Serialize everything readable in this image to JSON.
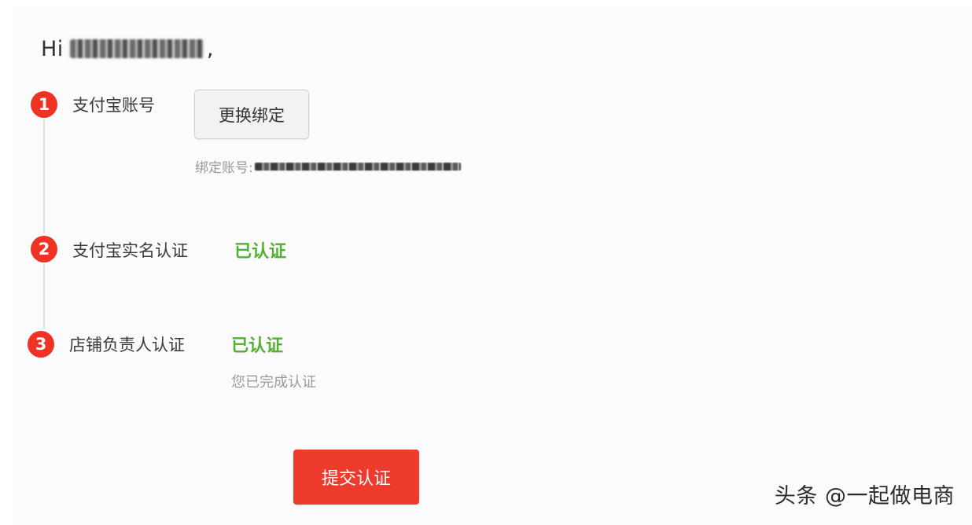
{
  "greeting": {
    "prefix": "Hi",
    "username_masked": "[redacted]",
    "suffix": ","
  },
  "steps": [
    {
      "number": "1",
      "label": "支付宝账号",
      "action_label": "更换绑定",
      "account_prefix": "绑定账号:",
      "account_value_masked": "[redacted]"
    },
    {
      "number": "2",
      "label": "支付宝实名认证",
      "status": "已认证"
    },
    {
      "number": "3",
      "label": "店铺负责人认证",
      "status": "已认证",
      "hint": "您已完成认证"
    }
  ],
  "submit_label": "提交认证",
  "watermark": "头条 @一起做电商",
  "colors": {
    "accent_red": "#ee3324",
    "status_green": "#52b12d",
    "hint_gray": "#9a9a9a"
  }
}
